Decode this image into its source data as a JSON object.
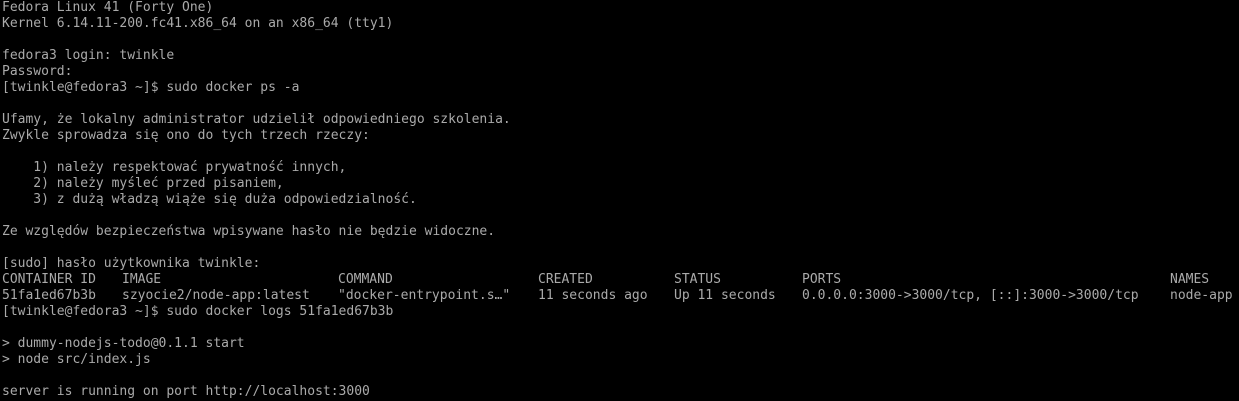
{
  "terminal": {
    "banner": [
      "Fedora Linux 41 (Forty One)",
      "Kernel 6.14.11-200.fc41.x86_64 on an x86_64 (tty1)"
    ],
    "login_line": "fedora3 login: twinkle",
    "password_line": "Password:",
    "prompt1": "[twinkle@fedora3 ~]$ sudo docker ps -a",
    "lecture": [
      "Ufamy, że lokalny administrator udzielił odpowiedniego szkolenia.",
      "Zwykle sprowadza się ono do tych trzech rzeczy:",
      "",
      "    1) należy respektować prywatność innych,",
      "    2) należy myśleć przed pisaniem,",
      "    3) z dużą władzą wiąże się duża odpowiedzialność.",
      "",
      "Ze względów bezpieczeństwa wpisywane hasło nie będzie widoczne.",
      ""
    ],
    "sudo_prompt": "[sudo] hasło użytkownika twinkle:",
    "table": {
      "headers": {
        "id": "CONTAINER ID",
        "image": "IMAGE",
        "command": "COMMAND",
        "created": "CREATED",
        "status": "STATUS",
        "ports": "PORTS",
        "names": "NAMES"
      },
      "rows": [
        {
          "id": "51fa1ed67b3b",
          "image": "szyocie2/node-app:latest",
          "command": "\"docker-entrypoint.s…\"",
          "created": "11 seconds ago",
          "status": "Up 11 seconds",
          "ports": "0.0.0.0:3000->3000/tcp, [::]:3000->3000/tcp",
          "names": "node-app"
        }
      ]
    },
    "prompt2": "[twinkle@fedora3 ~]$ sudo docker logs 51fa1ed67b3b",
    "logs": [
      "",
      "> dummy-nodejs-todo@0.1.1 start",
      "> node src/index.js",
      "",
      "server is running on port http://localhost:3000"
    ]
  }
}
